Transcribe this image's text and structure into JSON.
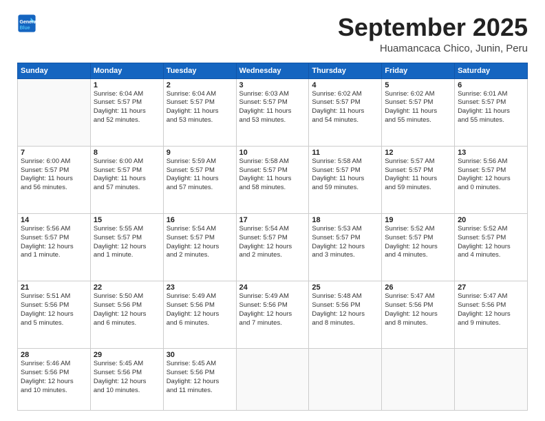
{
  "logo": {
    "line1": "General",
    "line2": "Blue"
  },
  "title": "September 2025",
  "location": "Huamancaca Chico, Junin, Peru",
  "header": {
    "days": [
      "Sunday",
      "Monday",
      "Tuesday",
      "Wednesday",
      "Thursday",
      "Friday",
      "Saturday"
    ]
  },
  "weeks": [
    [
      {
        "day": "",
        "info": ""
      },
      {
        "day": "1",
        "info": "Sunrise: 6:04 AM\nSunset: 5:57 PM\nDaylight: 11 hours\nand 52 minutes."
      },
      {
        "day": "2",
        "info": "Sunrise: 6:04 AM\nSunset: 5:57 PM\nDaylight: 11 hours\nand 53 minutes."
      },
      {
        "day": "3",
        "info": "Sunrise: 6:03 AM\nSunset: 5:57 PM\nDaylight: 11 hours\nand 53 minutes."
      },
      {
        "day": "4",
        "info": "Sunrise: 6:02 AM\nSunset: 5:57 PM\nDaylight: 11 hours\nand 54 minutes."
      },
      {
        "day": "5",
        "info": "Sunrise: 6:02 AM\nSunset: 5:57 PM\nDaylight: 11 hours\nand 55 minutes."
      },
      {
        "day": "6",
        "info": "Sunrise: 6:01 AM\nSunset: 5:57 PM\nDaylight: 11 hours\nand 55 minutes."
      }
    ],
    [
      {
        "day": "7",
        "info": "Sunrise: 6:00 AM\nSunset: 5:57 PM\nDaylight: 11 hours\nand 56 minutes."
      },
      {
        "day": "8",
        "info": "Sunrise: 6:00 AM\nSunset: 5:57 PM\nDaylight: 11 hours\nand 57 minutes."
      },
      {
        "day": "9",
        "info": "Sunrise: 5:59 AM\nSunset: 5:57 PM\nDaylight: 11 hours\nand 57 minutes."
      },
      {
        "day": "10",
        "info": "Sunrise: 5:58 AM\nSunset: 5:57 PM\nDaylight: 11 hours\nand 58 minutes."
      },
      {
        "day": "11",
        "info": "Sunrise: 5:58 AM\nSunset: 5:57 PM\nDaylight: 11 hours\nand 59 minutes."
      },
      {
        "day": "12",
        "info": "Sunrise: 5:57 AM\nSunset: 5:57 PM\nDaylight: 11 hours\nand 59 minutes."
      },
      {
        "day": "13",
        "info": "Sunrise: 5:56 AM\nSunset: 5:57 PM\nDaylight: 12 hours\nand 0 minutes."
      }
    ],
    [
      {
        "day": "14",
        "info": "Sunrise: 5:56 AM\nSunset: 5:57 PM\nDaylight: 12 hours\nand 1 minute."
      },
      {
        "day": "15",
        "info": "Sunrise: 5:55 AM\nSunset: 5:57 PM\nDaylight: 12 hours\nand 1 minute."
      },
      {
        "day": "16",
        "info": "Sunrise: 5:54 AM\nSunset: 5:57 PM\nDaylight: 12 hours\nand 2 minutes."
      },
      {
        "day": "17",
        "info": "Sunrise: 5:54 AM\nSunset: 5:57 PM\nDaylight: 12 hours\nand 2 minutes."
      },
      {
        "day": "18",
        "info": "Sunrise: 5:53 AM\nSunset: 5:57 PM\nDaylight: 12 hours\nand 3 minutes."
      },
      {
        "day": "19",
        "info": "Sunrise: 5:52 AM\nSunset: 5:57 PM\nDaylight: 12 hours\nand 4 minutes."
      },
      {
        "day": "20",
        "info": "Sunrise: 5:52 AM\nSunset: 5:57 PM\nDaylight: 12 hours\nand 4 minutes."
      }
    ],
    [
      {
        "day": "21",
        "info": "Sunrise: 5:51 AM\nSunset: 5:56 PM\nDaylight: 12 hours\nand 5 minutes."
      },
      {
        "day": "22",
        "info": "Sunrise: 5:50 AM\nSunset: 5:56 PM\nDaylight: 12 hours\nand 6 minutes."
      },
      {
        "day": "23",
        "info": "Sunrise: 5:49 AM\nSunset: 5:56 PM\nDaylight: 12 hours\nand 6 minutes."
      },
      {
        "day": "24",
        "info": "Sunrise: 5:49 AM\nSunset: 5:56 PM\nDaylight: 12 hours\nand 7 minutes."
      },
      {
        "day": "25",
        "info": "Sunrise: 5:48 AM\nSunset: 5:56 PM\nDaylight: 12 hours\nand 8 minutes."
      },
      {
        "day": "26",
        "info": "Sunrise: 5:47 AM\nSunset: 5:56 PM\nDaylight: 12 hours\nand 8 minutes."
      },
      {
        "day": "27",
        "info": "Sunrise: 5:47 AM\nSunset: 5:56 PM\nDaylight: 12 hours\nand 9 minutes."
      }
    ],
    [
      {
        "day": "28",
        "info": "Sunrise: 5:46 AM\nSunset: 5:56 PM\nDaylight: 12 hours\nand 10 minutes."
      },
      {
        "day": "29",
        "info": "Sunrise: 5:45 AM\nSunset: 5:56 PM\nDaylight: 12 hours\nand 10 minutes."
      },
      {
        "day": "30",
        "info": "Sunrise: 5:45 AM\nSunset: 5:56 PM\nDaylight: 12 hours\nand 11 minutes."
      },
      {
        "day": "",
        "info": ""
      },
      {
        "day": "",
        "info": ""
      },
      {
        "day": "",
        "info": ""
      },
      {
        "day": "",
        "info": ""
      }
    ]
  ]
}
